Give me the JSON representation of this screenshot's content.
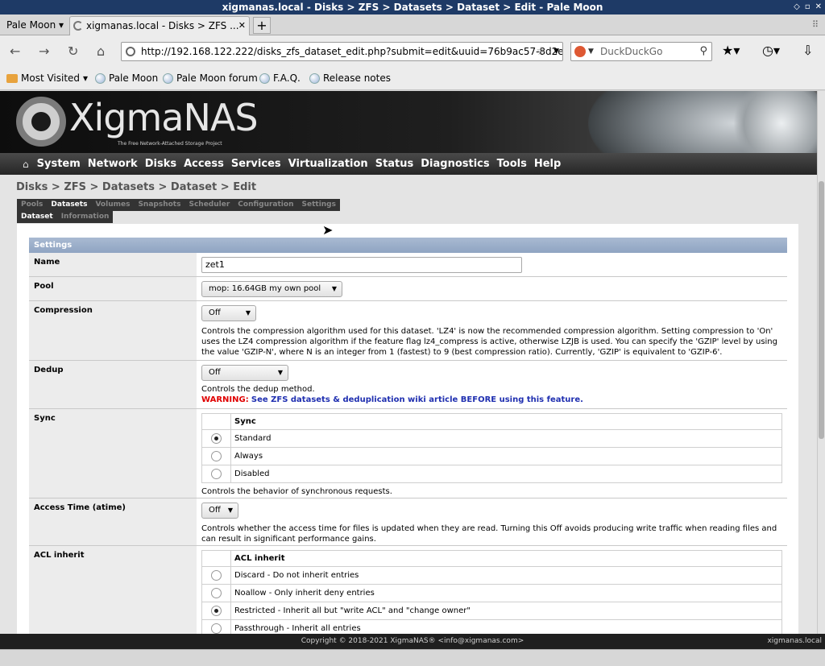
{
  "window": {
    "title": "xigmanas.local - Disks > ZFS > Datasets > Dataset > Edit - Pale Moon"
  },
  "browser": {
    "app_menu": "Pale Moon",
    "tab_title": "xigmanas.local - Disks > ZFS ...",
    "url": "http://192.168.122.222/disks_zfs_dataset_edit.php?submit=edit&uuid=76b9ac57-8d2e",
    "search_placeholder": "DuckDuckGo",
    "bookmarks": [
      "Most Visited",
      "Pale Moon",
      "Pale Moon forum",
      "F.A.Q.",
      "Release notes"
    ]
  },
  "logo": {
    "text": "XigmaNAS",
    "tagline": "The Free Network-Attached Storage Project"
  },
  "nav": [
    "System",
    "Network",
    "Disks",
    "Access",
    "Services",
    "Virtualization",
    "Status",
    "Diagnostics",
    "Tools",
    "Help"
  ],
  "breadcrumb": "Disks > ZFS > Datasets > Dataset > Edit",
  "tabs_level1": [
    {
      "label": "Pools",
      "active": false
    },
    {
      "label": "Datasets",
      "active": true
    },
    {
      "label": "Volumes",
      "active": false
    },
    {
      "label": "Snapshots",
      "active": false
    },
    {
      "label": "Scheduler",
      "active": false
    },
    {
      "label": "Configuration",
      "active": false
    },
    {
      "label": "Settings",
      "active": false
    }
  ],
  "tabs_level2": [
    {
      "label": "Dataset",
      "active": true
    },
    {
      "label": "Information",
      "active": false
    }
  ],
  "form": {
    "section_title": "Settings",
    "name": {
      "label": "Name",
      "value": "zet1"
    },
    "pool": {
      "label": "Pool",
      "value": "mop: 16.64GB my own pool"
    },
    "compression": {
      "label": "Compression",
      "value": "Off",
      "desc": "Controls the compression algorithm used for this dataset. 'LZ4' is now the recommended compression algorithm. Setting compression to 'On' uses the LZ4 compression algorithm if the feature flag lz4_compress is active, otherwise LZJB is used. You can specify the 'GZIP' level by using the value 'GZIP-N', where N is an integer from 1 (fastest) to 9 (best compression ratio). Currently, 'GZIP' is equivalent to 'GZIP-6'."
    },
    "dedup": {
      "label": "Dedup",
      "value": "Off",
      "desc": "Controls the dedup method.",
      "warning_label": "WARNING:",
      "warning_link": "See ZFS datasets & deduplication wiki article BEFORE using this feature."
    },
    "sync": {
      "label": "Sync",
      "header": "Sync",
      "options": [
        "Standard",
        "Always",
        "Disabled"
      ],
      "selected": "Standard",
      "desc": "Controls the behavior of synchronous requests."
    },
    "atime": {
      "label": "Access Time (atime)",
      "value": "Off",
      "desc": "Controls whether the access time for files is updated when they are read. Turning this Off avoids producing write traffic when reading files and can result in significant performance gains."
    },
    "aclinherit": {
      "label": "ACL inherit",
      "header": "ACL inherit",
      "options": [
        "Discard - Do not inherit entries",
        "Noallow - Only inherit deny entries",
        "Restricted - Inherit all but \"write ACL\" and \"change owner\"",
        "Passthrough - Inherit all entries"
      ],
      "selected": "Restricted - Inherit all but \"write ACL\" and \"change owner\""
    }
  },
  "footer": {
    "copyright": "Copyright © 2018-2021 XigmaNAS® <info@xigmanas.com>",
    "host": "xigmanas.local"
  }
}
